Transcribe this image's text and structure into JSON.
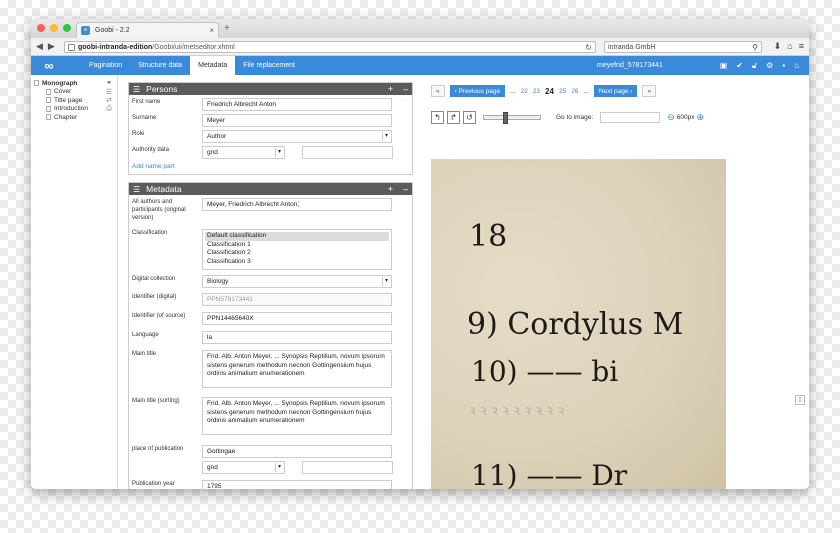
{
  "browser": {
    "tab_title": "Goobi - 2.2",
    "url_host": "goobi-intranda-edition",
    "url_path": "/Goobi/uii/metseditor.xhtml",
    "search_text": "intranda GmbH"
  },
  "app": {
    "logo": "∞",
    "tabs": [
      {
        "label": "Pagination"
      },
      {
        "label": "Structure data"
      },
      {
        "label": "Metadata"
      },
      {
        "label": "File replacement"
      }
    ],
    "user": "meyefrid_578173441",
    "accent": "#3a8ad9"
  },
  "tree": {
    "root": "Monograph",
    "children": [
      "Cover",
      "Title page",
      "Introduction",
      "Chapter"
    ]
  },
  "persons": {
    "title": "Persons",
    "fields": {
      "first_name_label": "First name",
      "first_name_value": "Friedrich Albrecht Anton",
      "surname_label": "Surname",
      "surname_value": "Meyer",
      "role_label": "Role",
      "role_value": "Author",
      "authority_label": "Authority data",
      "authority_value": "gnd"
    },
    "add_name_part": "Add name part"
  },
  "metadata": {
    "title": "Metadata",
    "authors_label": "All authors and participants (original version)",
    "authors_value": "Meyer, Friedrich Albrecht Anton;",
    "classification_label": "Classification",
    "classification_options": [
      "Default classification",
      "Classification 1",
      "Classification 2",
      "Classification 3"
    ],
    "digital_collection_label": "Digital collection",
    "digital_collection_value": "Biology",
    "identifier_digital_label": "Identifier (digital)",
    "identifier_digital_value": "PPN578173441",
    "identifier_source_label": "Identifier (of source)",
    "identifier_source_value": "PPN14465640X",
    "language_label": "Language",
    "language_value": "la",
    "main_title_label": "Main title",
    "main_title_value": "Frid. Alb. Anton Meyer, ... Synopsis Reptilium, novum ipsorum sistens generum methodum necnon Gottingensium hujus ordinis animalium enumerationem",
    "main_title_sorting_label": "Main title (sorting)",
    "main_title_sorting_value": "Frid. Alb. Anton Meyer, ... Synopsis Reptilium, novum ipsorum sistens generum methodum necnon Gottingensium hujus ordinis animalium enumerationem",
    "place_label": "place of publication",
    "place_value": "Gottingae",
    "place_authority_value": "gnd",
    "year_label": "Publication year",
    "year_value": "1795"
  },
  "viewer": {
    "first": "«",
    "prev": "‹ Previous page",
    "ellipsis": "...",
    "pages_before": [
      "22",
      "23"
    ],
    "current": "24",
    "pages_after": [
      "25",
      "26"
    ],
    "next": "Next page ›",
    "last": "»",
    "goto_label": "Go to image:",
    "zoom": "600px",
    "zoom_level": 0.35,
    "scan_lines": [
      "18",
      "9) Cordylus M",
      "10) —— bi",
      "11) —— Dr"
    ]
  }
}
